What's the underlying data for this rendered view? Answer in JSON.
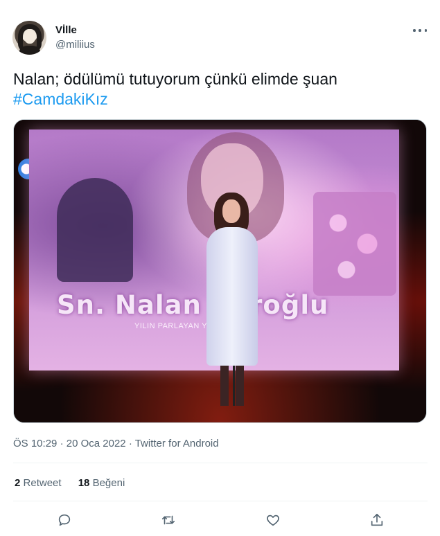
{
  "user": {
    "display_name": "Vİlle",
    "handle": "@miliius"
  },
  "tweet": {
    "text": "Nalan; ödülümü tutuyorum çünkü elimde şuan",
    "hashtag": "#CamdakiKız"
  },
  "media": {
    "screen_name_text": "Sn. Nalan Koroğlu",
    "screen_subtitle": "YILIN PARLAYAN YILDIZI"
  },
  "meta": {
    "time": "ÖS 10:29",
    "date": "20 Oca 2022",
    "source": "Twitter for Android",
    "separator": "·"
  },
  "stats": {
    "retweets_count": "2",
    "retweets_label": "Retweet",
    "likes_count": "18",
    "likes_label": "Beğeni"
  },
  "icons": {
    "more": "more-icon",
    "reply": "reply-icon",
    "retweet": "retweet-icon",
    "like": "heart-icon",
    "share": "share-icon"
  },
  "colors": {
    "accent": "#1d9bf0",
    "secondary_text": "#536471",
    "primary_text": "#0f1419"
  }
}
